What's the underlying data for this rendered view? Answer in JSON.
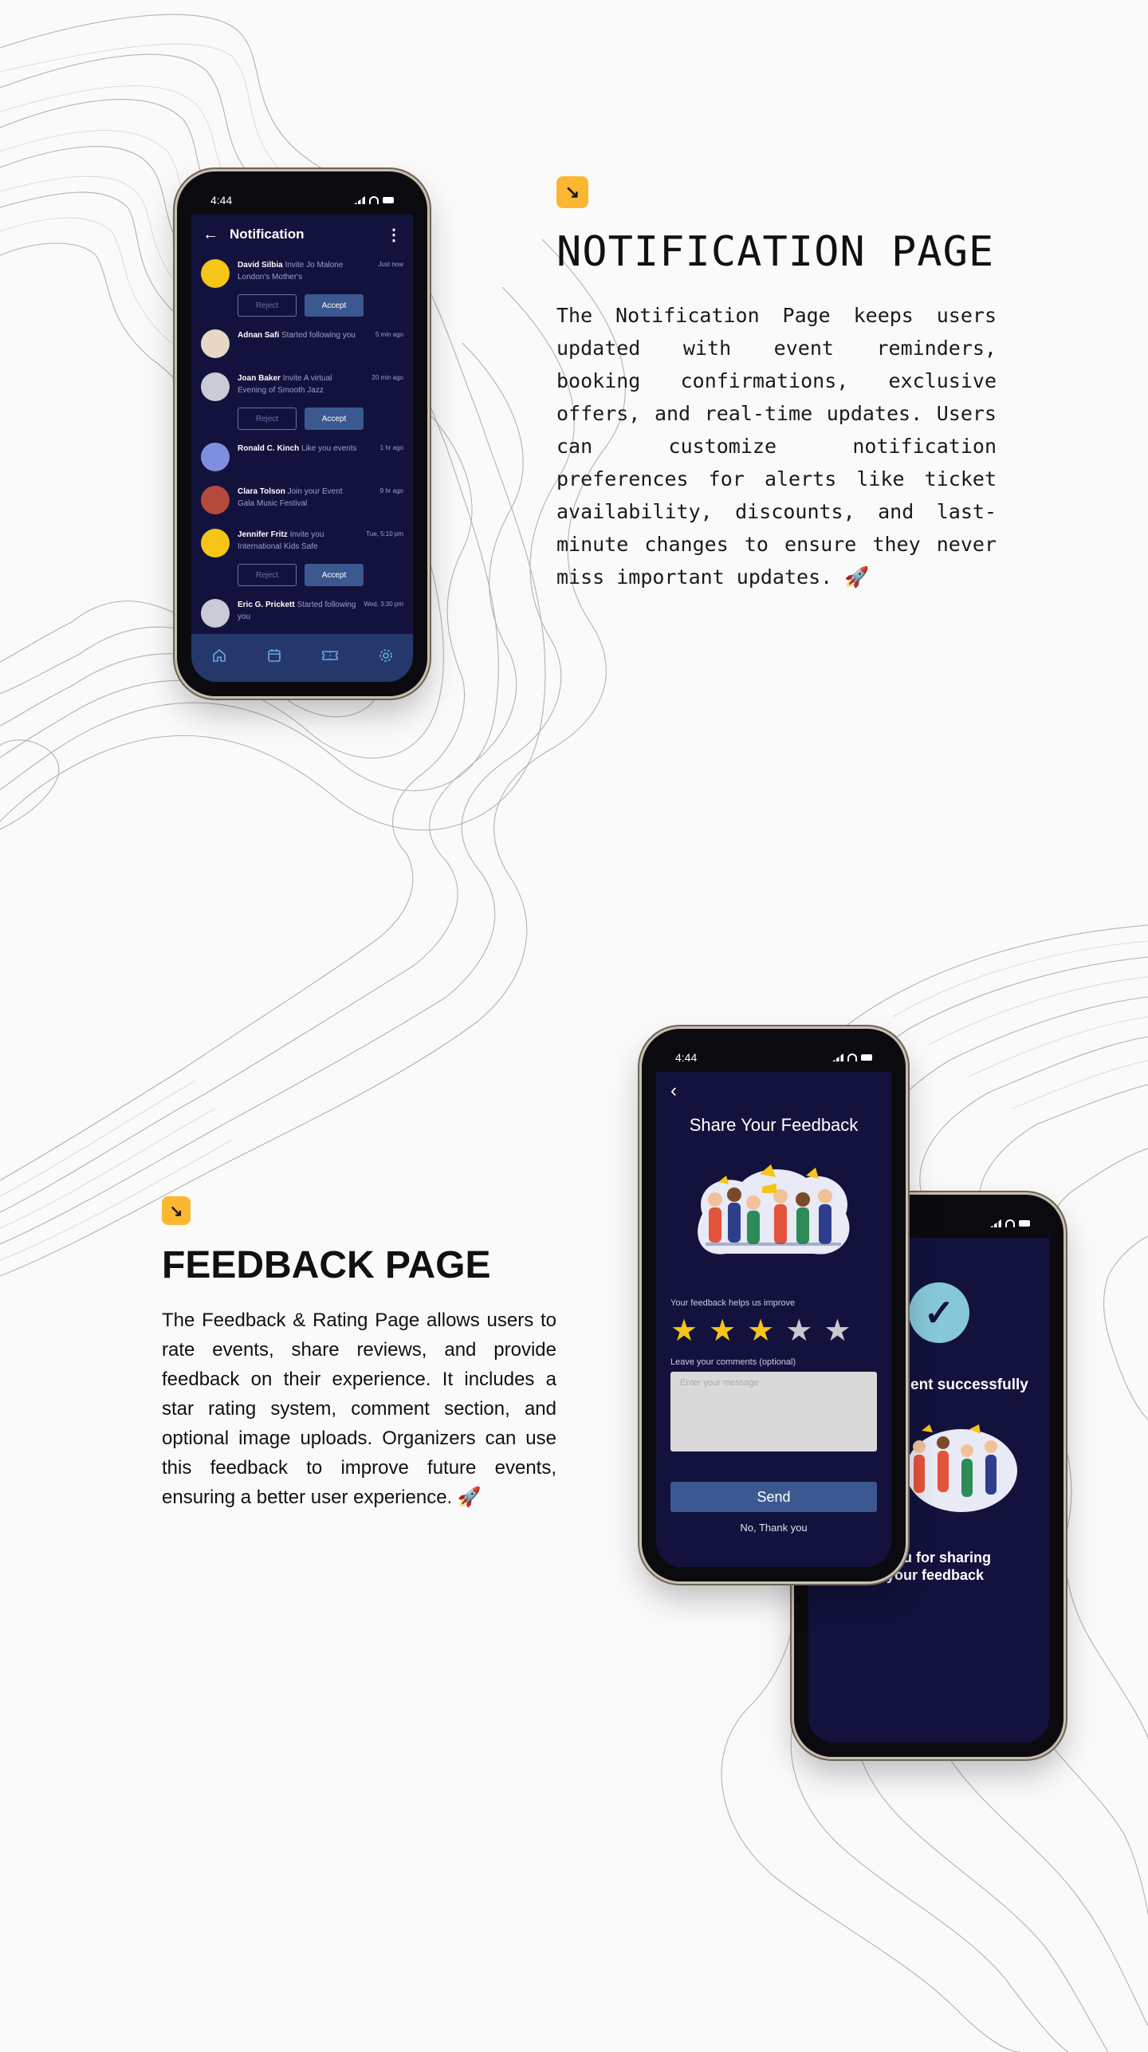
{
  "section_notification": {
    "badge_icon": "arrow-down-right-icon",
    "title": "NOTIFICATION PAGE",
    "text": "The Notification Page keeps users updated with event reminders, booking confirmations, exclusive offers, and real-time updates. Users can customize notification preferences for alerts like ticket availability, discounts, and last-minute changes to ensure they never miss important updates. 🚀"
  },
  "section_feedback": {
    "badge_icon": "arrow-down-right-icon",
    "title": "FEEDBACK PAGE",
    "text": "The Feedback & Rating Page allows users to rate events, share reviews, and provide feedback on their experience. It includes a star rating system, comment section, and optional image uploads. Organizers can use this feedback to improve future events, ensuring a better user experience. 🚀"
  },
  "notification_phone": {
    "time": "4:44",
    "header_title": "Notification",
    "items": [
      {
        "name": "David Silbia",
        "action": "Invite Jo Malone London's Mother's",
        "time": "Just now",
        "avatar_color": "#f5c518",
        "has_actions": true
      },
      {
        "name": "Adnan Safi",
        "action": "Started following you",
        "time": "5 min ago",
        "avatar_color": "#e6d7c6",
        "has_actions": false
      },
      {
        "name": "Joan Baker",
        "action": "Invite A virtual Evening of Smooth Jazz",
        "time": "20 min ago",
        "avatar_color": "#c9ccd6",
        "has_actions": true
      },
      {
        "name": "Ronald C. Kinch",
        "action": "Like you events",
        "time": "1 hr ago",
        "avatar_color": "#7e8fe0",
        "has_actions": false
      },
      {
        "name": "Clara Tolson",
        "action": "Join your Event Gala Music Festival",
        "time": "9 hr ago",
        "avatar_color": "#b44a3c",
        "has_actions": false
      },
      {
        "name": "Jennifer Fritz",
        "action": "Invite you International Kids Safe",
        "time": "Tue, 5:10 pm",
        "avatar_color": "#f5c518",
        "has_actions": true
      },
      {
        "name": "Eric G. Prickett",
        "action": "Started following you",
        "time": "Wed, 3:30 pm",
        "avatar_color": "#c9ccd6",
        "has_actions": false
      }
    ],
    "reject_label": "Reject",
    "accept_label": "Accept",
    "nav": [
      "home-icon",
      "calendar-icon",
      "ticket-icon",
      "settings-icon"
    ]
  },
  "feedback_phone": {
    "time": "4:44",
    "title": "Share Your Feedback",
    "helps_label": "Your feedback helps us improve",
    "rating": 3,
    "rating_max": 5,
    "comments_label": "Leave your comments (optional)",
    "placeholder": "Enter your message",
    "send_label": "Send",
    "skip_label": "No, Thank you"
  },
  "success_phone": {
    "sent_text": "ent successfully",
    "thanks_line1": "you for sharing",
    "thanks_line2": "your feedback"
  },
  "colors": {
    "accent": "#fbb731",
    "screen_bg": "#12123d",
    "button": "#3b5990",
    "star": "#f5c518"
  }
}
